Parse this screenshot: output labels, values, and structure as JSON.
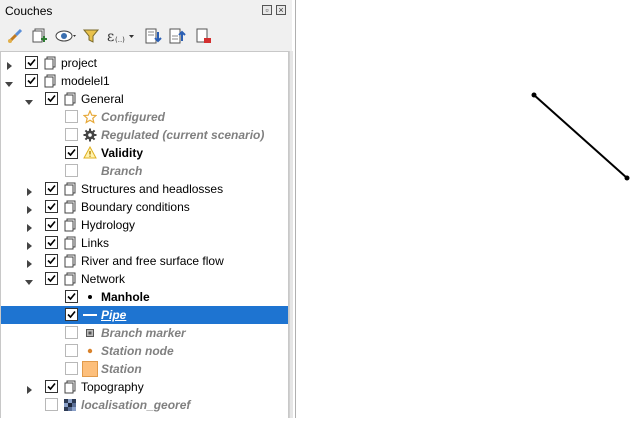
{
  "panel": {
    "title": "Couches"
  },
  "toolbar": {
    "items": [
      {
        "name": "style-manager-icon"
      },
      {
        "name": "add-group-icon"
      },
      {
        "name": "visibility-icon"
      },
      {
        "name": "filter-icon"
      },
      {
        "name": "expression-filter-icon"
      },
      {
        "name": "expand-all-icon"
      },
      {
        "name": "collapse-all-icon"
      },
      {
        "name": "remove-layer-icon"
      }
    ]
  },
  "tree": {
    "rows": [
      {
        "label": "project",
        "checked": true,
        "expanded": false,
        "icon": "group"
      },
      {
        "label": "modelel1",
        "checked": true,
        "expanded": true,
        "icon": "group"
      },
      {
        "label": "General",
        "checked": true,
        "expanded": true,
        "icon": "group"
      },
      {
        "label": "Configured",
        "checked": false,
        "icon": "star",
        "style": "muted"
      },
      {
        "label": "Regulated (current scenario)",
        "checked": false,
        "icon": "gear",
        "style": "muted"
      },
      {
        "label": "Validity",
        "checked": true,
        "icon": "warning",
        "style": "bold"
      },
      {
        "label": "Branch",
        "checked": false,
        "icon": "none",
        "style": "muted"
      },
      {
        "label": "Structures and headlosses",
        "checked": true,
        "expanded": false,
        "icon": "group"
      },
      {
        "label": "Boundary conditions",
        "checked": true,
        "expanded": false,
        "icon": "group"
      },
      {
        "label": "Hydrology",
        "checked": true,
        "expanded": false,
        "icon": "group"
      },
      {
        "label": "Links",
        "checked": true,
        "expanded": false,
        "icon": "group"
      },
      {
        "label": "River and free surface flow",
        "checked": true,
        "expanded": false,
        "icon": "group"
      },
      {
        "label": "Network",
        "checked": true,
        "expanded": true,
        "icon": "group"
      },
      {
        "label": "Manhole",
        "checked": true,
        "icon": "dot",
        "style": "bold"
      },
      {
        "label": "Pipe",
        "checked": true,
        "icon": "line",
        "style": "selected"
      },
      {
        "label": "Branch marker",
        "checked": false,
        "icon": "marker",
        "style": "muted"
      },
      {
        "label": "Station node",
        "checked": false,
        "icon": "orange-dot",
        "style": "muted"
      },
      {
        "label": "Station",
        "checked": false,
        "icon": "orange-square",
        "style": "muted"
      },
      {
        "label": "Topography",
        "checked": true,
        "expanded": false,
        "icon": "group"
      },
      {
        "label": "localisation_georef",
        "checked": false,
        "icon": "raster",
        "style": "muted"
      }
    ]
  },
  "colors": {
    "selection": "#1e74d1",
    "orange": "#f5a623"
  }
}
